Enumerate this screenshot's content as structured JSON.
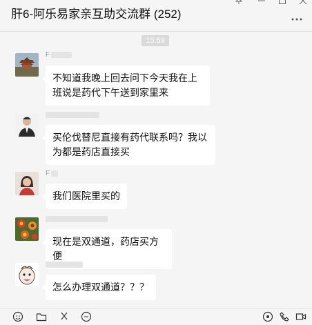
{
  "header": {
    "title": "肝6-阿乐易家亲互助交流群 (252)",
    "pin_icon": "pin-icon",
    "minimize_icon": "minimize-icon",
    "maximize_icon": "maximize-icon",
    "close_icon": "close-icon",
    "menu_icon": "more-dots-icon"
  },
  "timestamp": "15:59",
  "messages": [
    {
      "avatar": "pavilion-avatar",
      "text": "不知道我晚上回去问下今天我在上班说是药代下午送到家里来"
    },
    {
      "avatar": "man-suit-avatar",
      "text": "买伦伐替尼直接有药代联系吗？我以为都是药店直接买"
    },
    {
      "avatar": "woman-avatar",
      "text": "我们医院里买的"
    },
    {
      "avatar": "flower-avatar",
      "text": "现在是双通道，药店买方便"
    },
    {
      "avatar": "cartoon-avatar",
      "text": "怎么办理双通道？？？"
    }
  ],
  "toolbar": {
    "emoji_icon": "emoji-icon",
    "folder_icon": "folder-icon",
    "scissors_icon": "scissors-icon",
    "chat_icon": "chat-bubble-icon",
    "live_icon": "live-icon",
    "call_icon": "phone-icon",
    "video_icon": "video-icon"
  },
  "colors": {
    "background": "#f5f5f5",
    "bubble": "#ffffff",
    "timestamp_bg": "#dadada"
  }
}
